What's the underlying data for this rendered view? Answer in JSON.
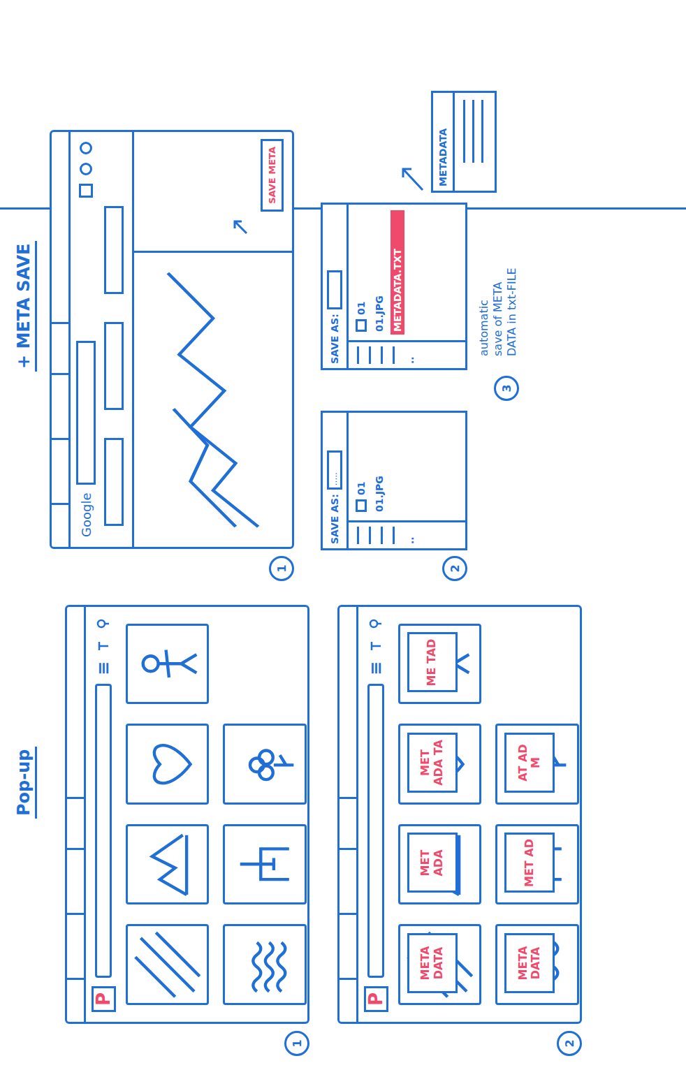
{
  "popup": {
    "title": "Pop-up",
    "screens": [
      {
        "number": "1",
        "logo": "P",
        "menu": "≡",
        "overlays": []
      },
      {
        "number": "2",
        "logo": "P",
        "menu": "≡",
        "overlays": [
          "META DATA",
          "MET ADA",
          "MET ADA TA",
          "ME TAD",
          "META DATA",
          "MET AD",
          "AT AD M"
        ]
      }
    ]
  },
  "metasave": {
    "title": "+ META SAVE",
    "browser": {
      "number": "1",
      "logo": "Google",
      "button": "SAVE META"
    },
    "dialogs": [
      {
        "number": "2",
        "label": "SAVE AS:",
        "field": ".....",
        "more": "..",
        "files": [
          {
            "name": "01",
            "kind": "folder",
            "selected": false
          },
          {
            "name": "01.JPG",
            "kind": "file",
            "selected": false
          }
        ]
      },
      {
        "number": "3",
        "label": "SAVE AS:",
        "field": "",
        "more": "..",
        "files": [
          {
            "name": "01",
            "kind": "folder",
            "selected": false
          },
          {
            "name": "01.JPG",
            "kind": "file",
            "selected": false
          },
          {
            "name": "METADATA.TXT",
            "kind": "file",
            "selected": true
          }
        ]
      }
    ],
    "file": {
      "title": "METADATA"
    },
    "caption": [
      "automatic",
      "save of META",
      "DATA in txt-FILE"
    ]
  }
}
